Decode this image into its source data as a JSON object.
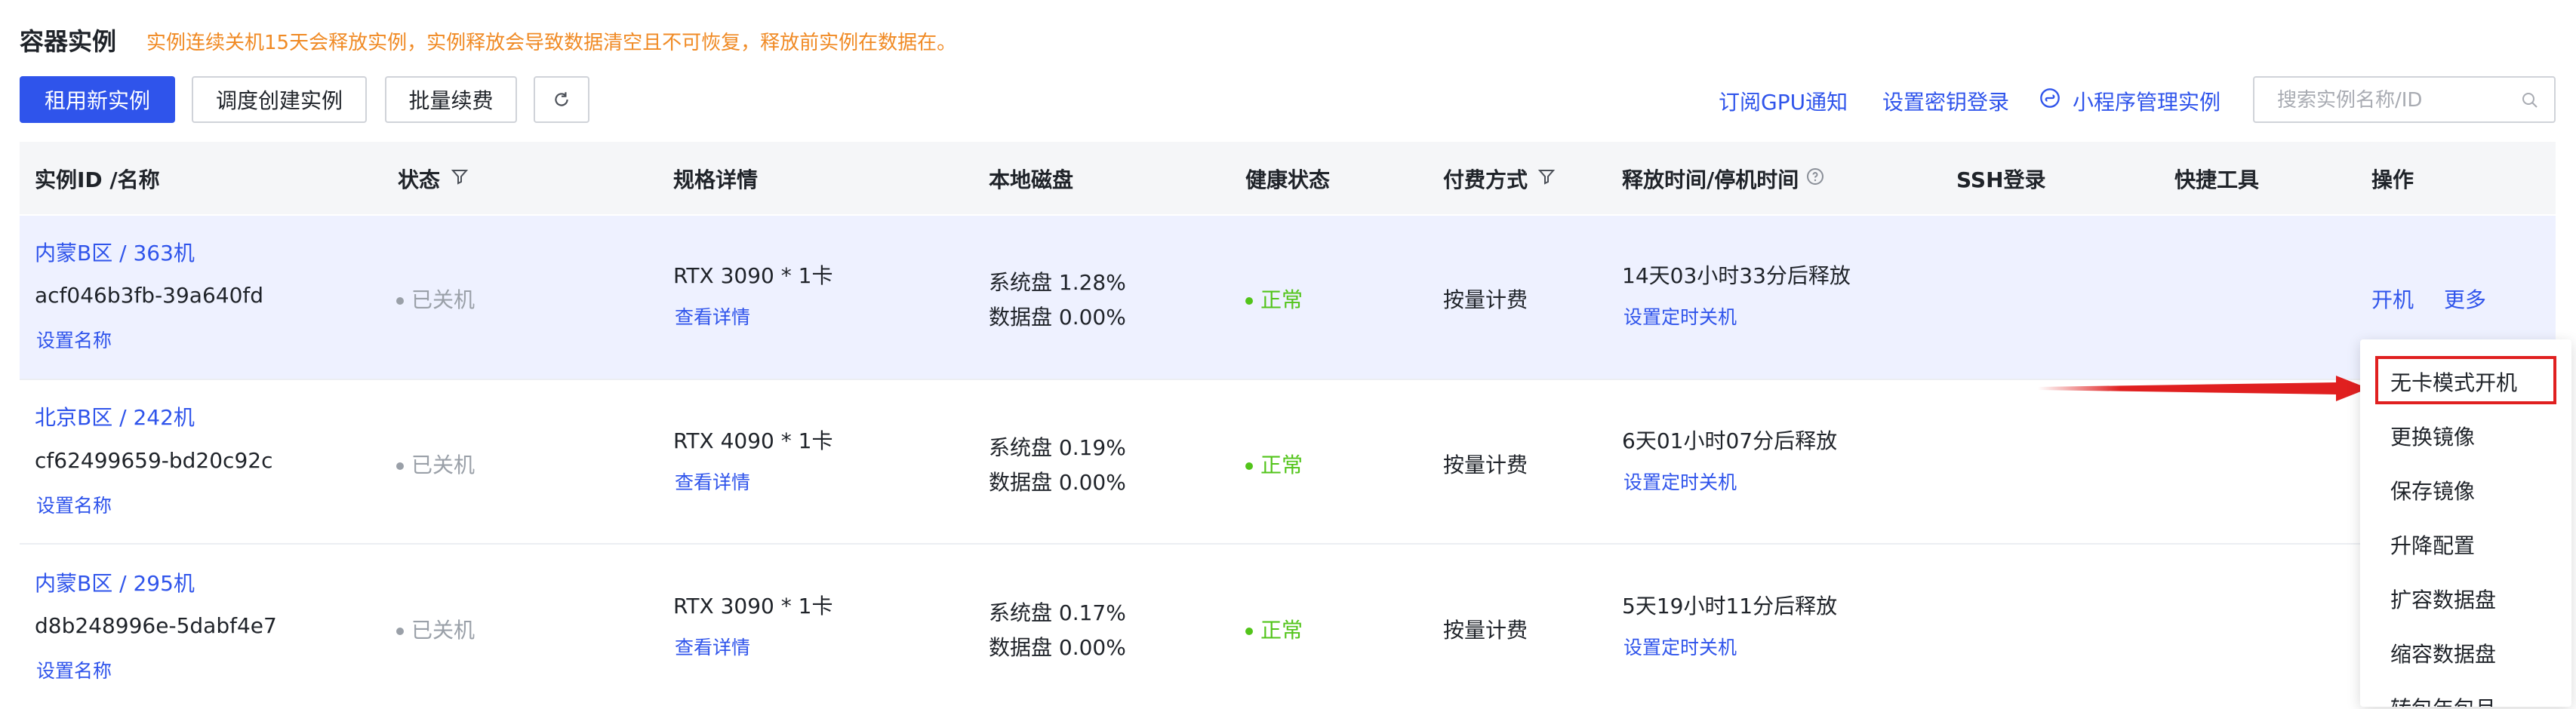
{
  "header": {
    "title": "容器实例",
    "notice": "实例连续关机15天会释放实例，实例释放会导致数据清空且不可恢复，释放前实例在数据在。"
  },
  "toolbar": {
    "rent_label": "租用新实例",
    "schedule_label": "调度创建实例",
    "renew_label": "批量续费",
    "gpu_notify": "订阅GPU通知",
    "key_login": "设置密钥登录",
    "mini_program": "小程序管理实例",
    "search_placeholder": "搜索实例名称/ID"
  },
  "table": {
    "columns": [
      "实例ID /名称",
      "状态",
      "规格详情",
      "本地磁盘",
      "健康状态",
      "付费方式",
      "释放时间/停机时间",
      "SSH登录",
      "快捷工具",
      "操作"
    ],
    "rows": [
      {
        "name": "内蒙B区 / 363机",
        "id": "acf046b3fb-39a640fd",
        "set_name": "设置名称",
        "status": "已关机",
        "spec": "RTX 3090 * 1卡",
        "spec_detail": "查看详情",
        "sys_disk": "系统盘 1.28%",
        "data_disk": "数据盘 0.00%",
        "health": "正常",
        "billing": "按量计费",
        "release": "14天03小时33分后释放",
        "timer": "设置定时关机",
        "op_start": "开机",
        "op_more": "更多"
      },
      {
        "name": "北京B区 / 242机",
        "id": "cf62499659-bd20c92c",
        "set_name": "设置名称",
        "status": "已关机",
        "spec": "RTX 4090 * 1卡",
        "spec_detail": "查看详情",
        "sys_disk": "系统盘 0.19%",
        "data_disk": "数据盘 0.00%",
        "health": "正常",
        "billing": "按量计费",
        "release": "6天01小时07分后释放",
        "timer": "设置定时关机"
      },
      {
        "name": "内蒙B区 / 295机",
        "id": "d8b248996e-5dabf4e7",
        "set_name": "设置名称",
        "status": "已关机",
        "spec": "RTX 3090 * 1卡",
        "spec_detail": "查看详情",
        "sys_disk": "系统盘 0.17%",
        "data_disk": "数据盘 0.00%",
        "health": "正常",
        "billing": "按量计费",
        "release": "5天19小时11分后释放",
        "timer": "设置定时关机"
      }
    ]
  },
  "more_menu": {
    "items": [
      "无卡模式开机",
      "更换镜像",
      "保存镜像",
      "升降配置",
      "扩容数据盘",
      "缩容数据盘",
      "转包年包月"
    ],
    "highlighted": "无卡模式开机"
  },
  "colors": {
    "primary": "#2f54eb",
    "notice": "#f08a24",
    "ok": "#52c41a",
    "annotation": "#e02020"
  }
}
